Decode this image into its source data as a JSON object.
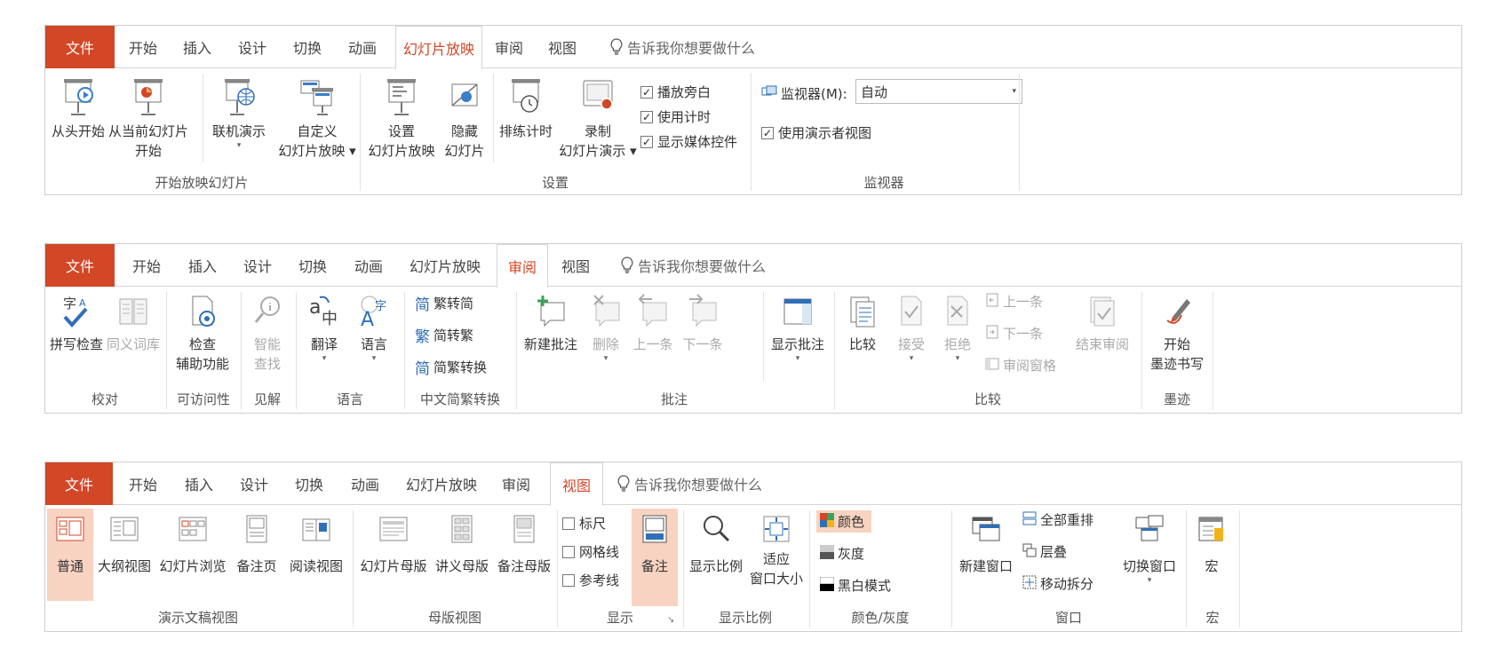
{
  "file_tab": "文件",
  "tell_me": "告诉我你想要做什么",
  "ribbon1": {
    "tabs": [
      "开始",
      "插入",
      "设计",
      "切换",
      "动画",
      "幻灯片放映",
      "审阅",
      "视图"
    ],
    "active_tab": "幻灯片放映",
    "groups": {
      "start_slideshow": {
        "label": "开始放映幻灯片",
        "from_beginning": "从头开始",
        "from_current_1": "从当前幻灯片",
        "from_current_2": "开始",
        "present_online": "联机演示",
        "custom_1": "自定义",
        "custom_2": "幻灯片放映"
      },
      "setup": {
        "label": "设置",
        "setup_1": "设置",
        "setup_2": "幻灯片放映",
        "hide_1": "隐藏",
        "hide_2": "幻灯片",
        "rehearse": "排练计时",
        "record_1": "录制",
        "record_2": "幻灯片演示",
        "play_narrations": "播放旁白",
        "use_timings": "使用计时",
        "show_media_controls": "显示媒体控件"
      },
      "monitors": {
        "label": "监视器",
        "monitor_label": "监视器(M):",
        "monitor_value": "自动",
        "presenter_view": "使用演示者视图"
      }
    }
  },
  "ribbon2": {
    "tabs": [
      "开始",
      "插入",
      "设计",
      "切换",
      "动画",
      "幻灯片放映",
      "审阅",
      "视图"
    ],
    "active_tab": "审阅",
    "groups": {
      "proofing": {
        "label": "校对",
        "spelling": "拼写检查",
        "thesaurus": "同义词库"
      },
      "accessibility": {
        "label": "可访问性",
        "check_1": "检查",
        "check_2": "辅助功能"
      },
      "insights": {
        "label": "见解",
        "smart_1": "智能",
        "smart_2": "查找"
      },
      "language": {
        "label": "语言",
        "translate": "翻译",
        "language": "语言"
      },
      "chinese_conversion": {
        "label": "中文简繁转换",
        "to_simplified": "繁转简",
        "to_traditional": "简转繁",
        "conversion": "简繁转换",
        "g1": "简",
        "g2": "繁",
        "g3": "简"
      },
      "comments": {
        "label": "批注",
        "new": "新建批注",
        "delete": "删除",
        "prev": "上一条",
        "next": "下一条",
        "show": "显示批注"
      },
      "compare": {
        "label": "比较",
        "compare": "比较",
        "accept": "接受",
        "reject": "拒绝",
        "prev": "上一条",
        "next": "下一条",
        "pane": "审阅窗格",
        "end": "结束审阅"
      },
      "ink": {
        "label": "墨迹",
        "start_1": "开始",
        "start_2": "墨迹书写"
      }
    }
  },
  "ribbon3": {
    "tabs": [
      "开始",
      "插入",
      "设计",
      "切换",
      "动画",
      "幻灯片放映",
      "审阅",
      "视图"
    ],
    "active_tab": "视图",
    "groups": {
      "presentation_views": {
        "label": "演示文稿视图",
        "normal": "普通",
        "outline": "大纲视图",
        "sorter": "幻灯片浏览",
        "notes_page": "备注页",
        "reading": "阅读视图"
      },
      "master_views": {
        "label": "母版视图",
        "slide_master": "幻灯片母版",
        "handout_master": "讲义母版",
        "notes_master": "备注母版"
      },
      "show": {
        "label": "显示",
        "ruler": "标尺",
        "gridlines": "网格线",
        "guides": "参考线",
        "notes": "备注"
      },
      "zoom": {
        "label": "显示比例",
        "zoom": "显示比例",
        "fit_1": "适应",
        "fit_2": "窗口大小"
      },
      "color": {
        "label": "颜色/灰度",
        "color": "颜色",
        "grayscale": "灰度",
        "bw": "黑白模式"
      },
      "window": {
        "label": "窗口",
        "new_window": "新建窗口",
        "arrange_all": "全部重排",
        "cascade": "层叠",
        "move_split": "移动拆分",
        "switch_windows": "切换窗口"
      },
      "macros": {
        "label": "宏",
        "macros": "宏"
      }
    }
  }
}
